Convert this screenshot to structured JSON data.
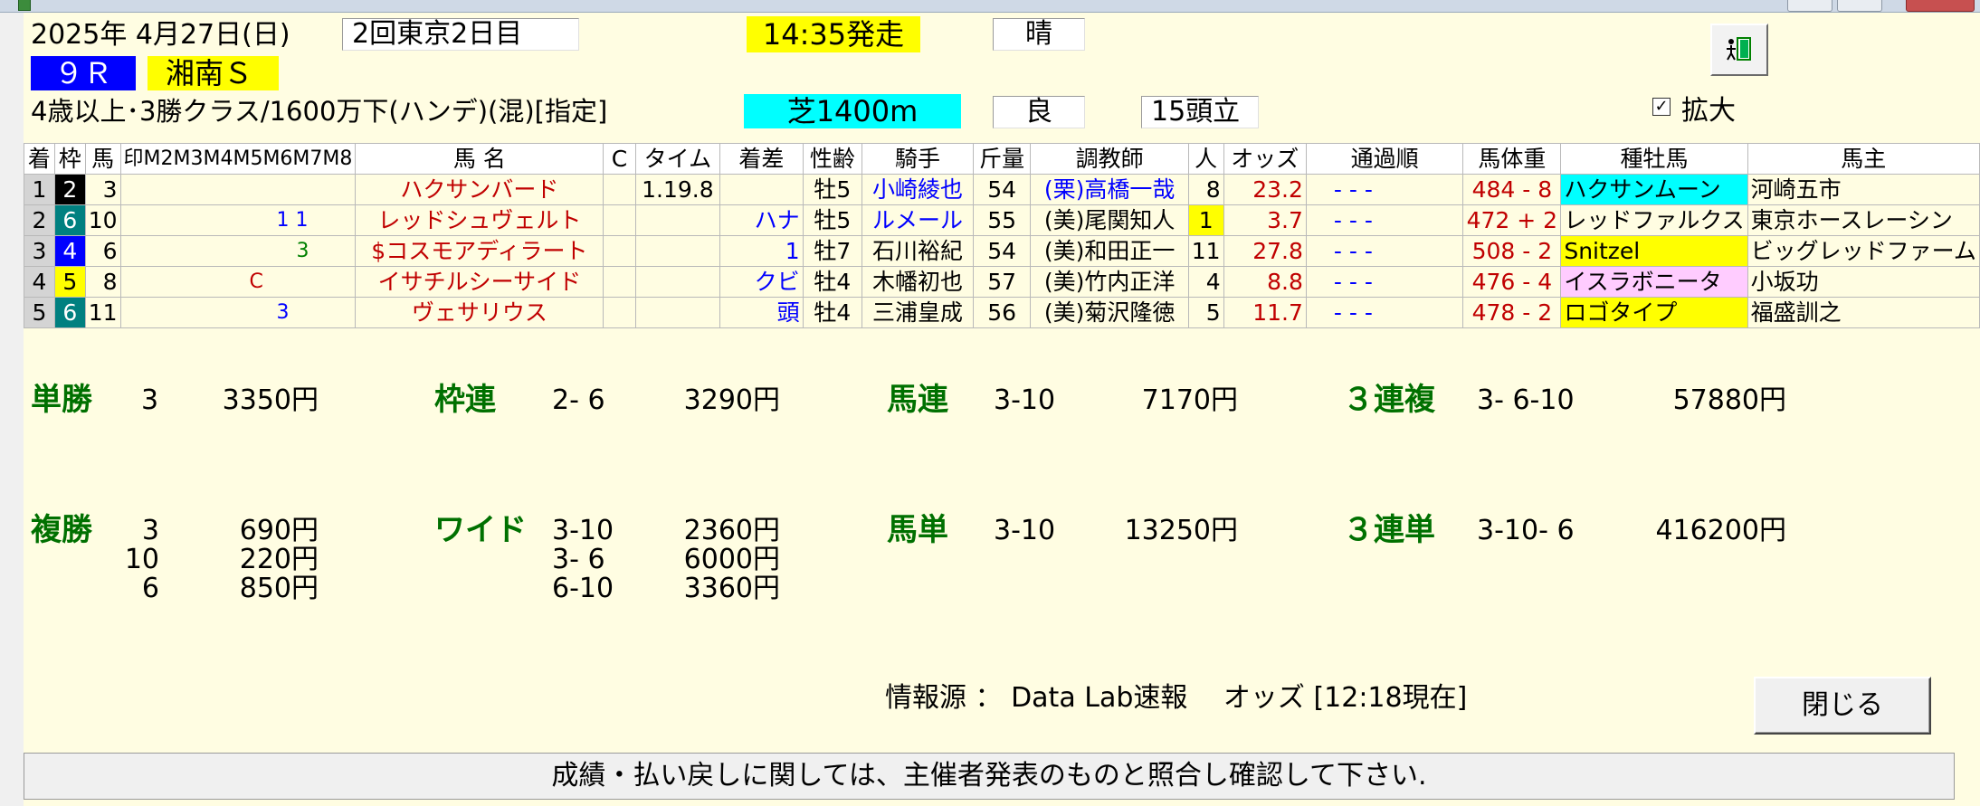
{
  "window": {
    "icon": "horse-app-icon"
  },
  "race": {
    "date": "2025年 4月27日(日)",
    "meeting": "2回東京2日目",
    "post_time": "14:35発走",
    "weather": "晴",
    "number": "９Ｒ",
    "name": "湘南Ｓ",
    "conditions": "4歳以上･3勝クラス/1600万下(ハンデ)(混)[指定]",
    "course": "芝1400m",
    "going": "良",
    "runners": "15頭立",
    "enlarge_checked": "✓",
    "enlarge_label": "拡大"
  },
  "table": {
    "headers": [
      "着",
      "枠",
      "馬",
      "印M2M3M4M5M6M7M8",
      "馬 名",
      "C",
      "タイム",
      "着差",
      "性齢",
      "騎手",
      "斤量",
      "調教師",
      "人",
      "オッズ",
      "通過順",
      "馬体重",
      "種牡馬",
      "馬主"
    ],
    "rows": [
      {
        "place": "1",
        "waku": "2",
        "umaban": "3",
        "marks": "",
        "name": "ハクサンバード",
        "c": "",
        "time": "1.19.8",
        "margin": "",
        "sexage": "牡5",
        "jockey": "小崎綾也",
        "weight": "54",
        "trainer": "(栗)高橋一哉",
        "pop": "8",
        "odds": "23.2",
        "passing": "-  -  -",
        "body": "484 - 8",
        "sire": "ハクサンムーン",
        "owner": "河崎五市"
      },
      {
        "place": "2",
        "waku": "6",
        "umaban": "10",
        "marks": "1   1",
        "name": "レッドシュヴェルト",
        "c": "",
        "time": "",
        "margin": "ハナ",
        "sexage": "牡5",
        "jockey": "ルメール",
        "weight": "55",
        "trainer": "(美)尾関知人",
        "pop": "1",
        "odds": "3.7",
        "passing": "-  -  -",
        "body": "472 + 2",
        "sire": "レッドファルクス",
        "owner": "東京ホースレーシン"
      },
      {
        "place": "3",
        "waku": "4",
        "umaban": "6",
        "marks": "3",
        "name": "$コスモアディラート",
        "c": "",
        "time": "",
        "margin": "1",
        "sexage": "牡7",
        "jockey": "石川裕紀",
        "weight": "54",
        "trainer": "(美)和田正一",
        "pop": "11",
        "odds": "27.8",
        "passing": "-  -  -",
        "body": "508 - 2",
        "sire": "Snitzel",
        "owner": "ビッグレッドファーム"
      },
      {
        "place": "4",
        "waku": "5",
        "umaban": "8",
        "marks": "C",
        "name": "イサチルシーサイド",
        "c": "",
        "time": "",
        "margin": "クビ",
        "sexage": "牡4",
        "jockey": "木幡初也",
        "weight": "57",
        "trainer": "(美)竹内正洋",
        "pop": "4",
        "odds": "8.8",
        "passing": "-  -  -",
        "body": "476 - 4",
        "sire": "イスラボニータ",
        "owner": "小坂功"
      },
      {
        "place": "5",
        "waku": "6",
        "umaban": "11",
        "marks": "3",
        "name": "ヴェサリウス",
        "c": "",
        "time": "",
        "margin": "頭",
        "sexage": "牡4",
        "jockey": "三浦皇成",
        "weight": "56",
        "trainer": "(美)菊沢隆徳",
        "pop": "5",
        "odds": "11.7",
        "passing": "-  -  -",
        "body": "478 - 2",
        "sire": "ロゴタイプ",
        "owner": "福盛訓之"
      }
    ]
  },
  "payouts": {
    "tansho": {
      "label": "単勝",
      "combo": "3",
      "amount": "3350円"
    },
    "wakuren": {
      "label": "枠連",
      "combo": "2- 6",
      "amount": "3290円"
    },
    "umaren": {
      "label": "馬連",
      "combo": "3-10",
      "amount": "7170円"
    },
    "sanrenpuku": {
      "label": "３連複",
      "combo": "3- 6-10",
      "amount": "57880円"
    },
    "fukusho": {
      "label": "複勝",
      "entries": [
        {
          "combo": "3",
          "amount": "690円"
        },
        {
          "combo": "10",
          "amount": "220円"
        },
        {
          "combo": "6",
          "amount": "850円"
        }
      ]
    },
    "wide": {
      "label": "ワイド",
      "entries": [
        {
          "combo": "3-10",
          "amount": "2360円"
        },
        {
          "combo": "3- 6",
          "amount": "6000円"
        },
        {
          "combo": "6-10",
          "amount": "3360円"
        }
      ]
    },
    "umatan": {
      "label": "馬単",
      "combo": "3-10",
      "amount": "13250円"
    },
    "sanrentan": {
      "label": "３連単",
      "combo": "3-10- 6",
      "amount": "416200円"
    }
  },
  "footer": {
    "info": "情報源 ： Data Lab速報　 オッズ [12:18現在]",
    "close_label": "閉じる",
    "note": "成績・払い戻しに関しては、主催者発表のものと照合し確認して下さい."
  },
  "colors": {
    "waku": {
      "2": "#000000",
      "4": "#0000ff",
      "5": "#ffff00",
      "6": "#008080"
    },
    "payout_label": "#007000",
    "panel": "#fffde2"
  }
}
